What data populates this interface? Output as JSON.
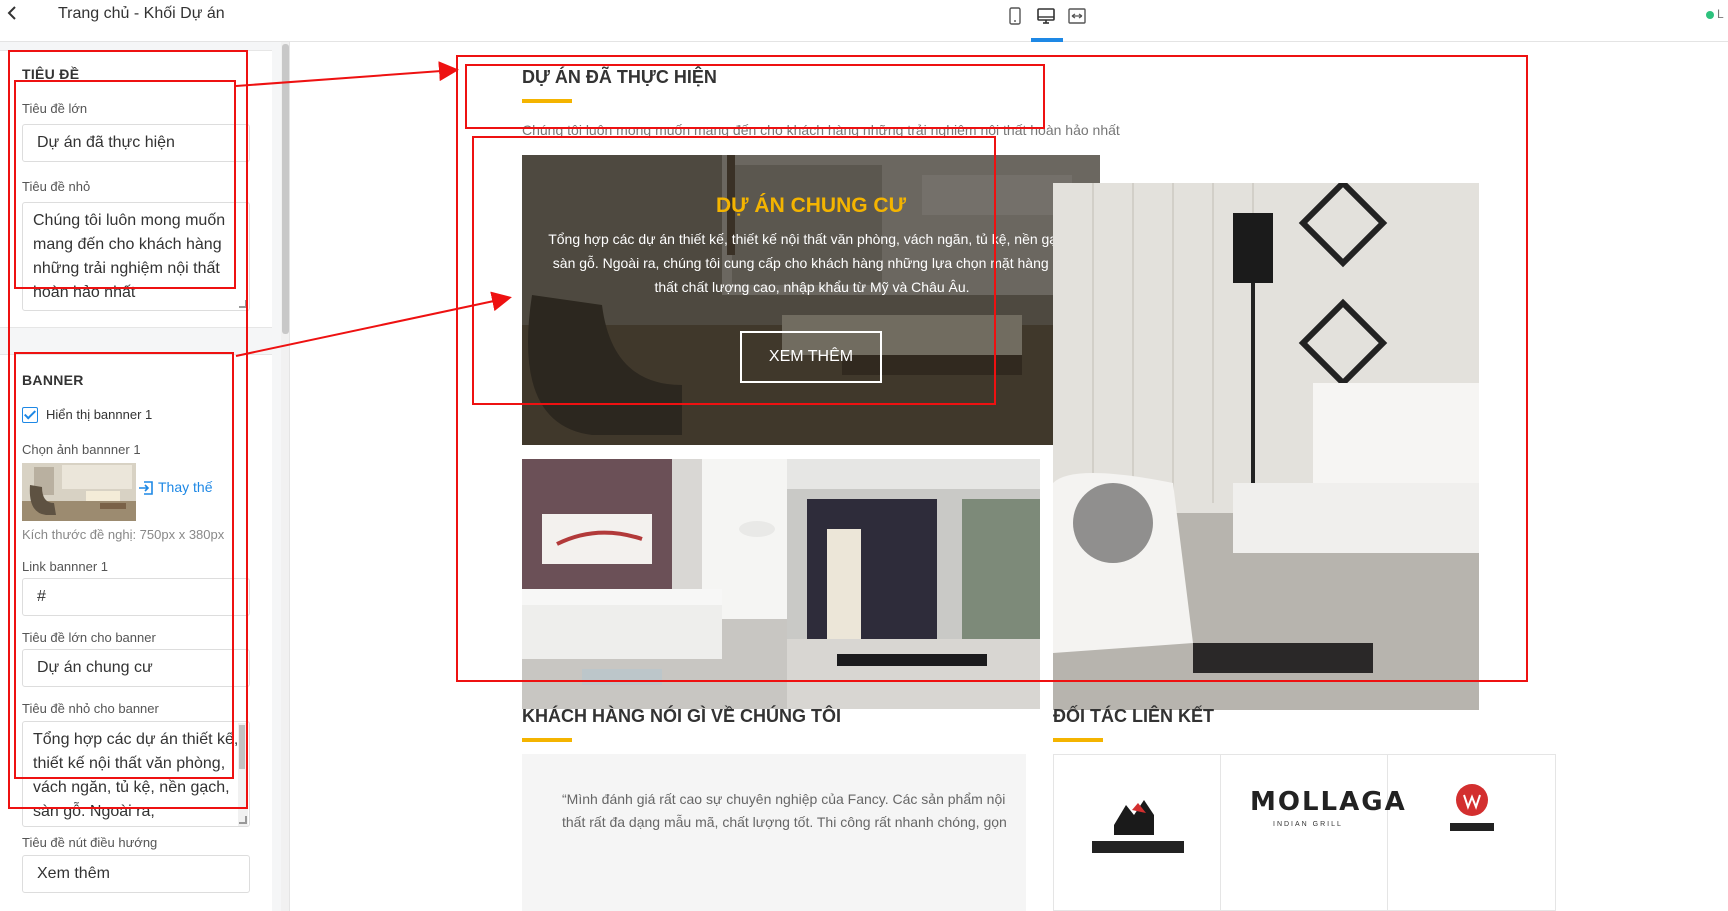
{
  "header": {
    "back_icon": "chevron-left-icon",
    "title": "Trang chủ - Khối Dự án",
    "devices": [
      "tablet-icon",
      "desktop-icon",
      "fullwidth-icon"
    ],
    "active_device": "desktop",
    "status_text": "L"
  },
  "sidebar": {
    "title_section": {
      "heading": "TIÊU ĐỀ",
      "big_title_label": "Tiêu đề lớn",
      "big_title_value": "Dự án đã thực hiện",
      "small_title_label": "Tiêu đề nhỏ",
      "small_title_value": "Chúng tôi luôn mong muốn mang đến cho khách hàng những trải nghiệm nội thất hoàn hảo nhất"
    },
    "banner_section": {
      "heading": "BANNER",
      "show_banner_label": "Hiển thị bannner 1",
      "show_banner_checked": true,
      "choose_image_label": "Chọn ảnh bannner 1",
      "replace_label": "Thay thế",
      "size_hint": "Kích thước đề nghị: 750px x 380px",
      "link_label": "Link bannner 1",
      "link_value": "#",
      "banner_big_title_label": "Tiêu đề lớn cho banner",
      "banner_big_title_value": "Dự án chung cư",
      "banner_small_title_label": "Tiêu đề nhỏ cho banner",
      "banner_small_title_value": "Tổng hợp các dự án thiết kế, thiết kế nội thất văn phòng, vách ngăn, tủ kệ, nền gạch, sàn gỗ. Ngoài ra,",
      "nav_button_label": "Tiêu đề nút điều hướng",
      "nav_button_value": "Xem thêm"
    }
  },
  "preview": {
    "projects": {
      "title": "DỰ ÁN ĐÃ THỰC HIỆN",
      "subtitle": "Chúng tôi luôn mong muốn mang đến cho khách hàng những trải nghiệm nội thất hoàn hảo nhất",
      "banner_title": "DỰ ÁN CHUNG CƯ",
      "banner_desc": "Tổng hợp các dự án thiết kế, thiết kế nội thất văn phòng, vách ngăn, tủ kệ, nền gạch, sàn gỗ. Ngoài ra, chúng tôi cung cấp cho khách hàng những lựa chọn mặt hàng nội thất chất lượng cao, nhập khẩu từ Mỹ và Châu Âu.",
      "banner_button": "XEM THÊM"
    },
    "testimonials": {
      "title": "KHÁCH HÀNG NÓI GÌ VỀ CHÚNG TÔI",
      "quote": "“Mình đánh giá rất cao sự chuyên nghiệp của Fancy. Các sản phẩm nội thất rất đa dạng mẫu mã, chất lượng tốt. Thi công rất nhanh chóng, gọn"
    },
    "partners": {
      "title": "ĐỐI TÁC LIÊN KẾT",
      "logos": [
        "InsightDecor",
        "MOLLAGA",
        "INDIAN GRILL",
        "WOLX"
      ]
    }
  },
  "colors": {
    "accent": "#f4b400",
    "link": "#1e88e5",
    "annotation": "#ee1111"
  }
}
